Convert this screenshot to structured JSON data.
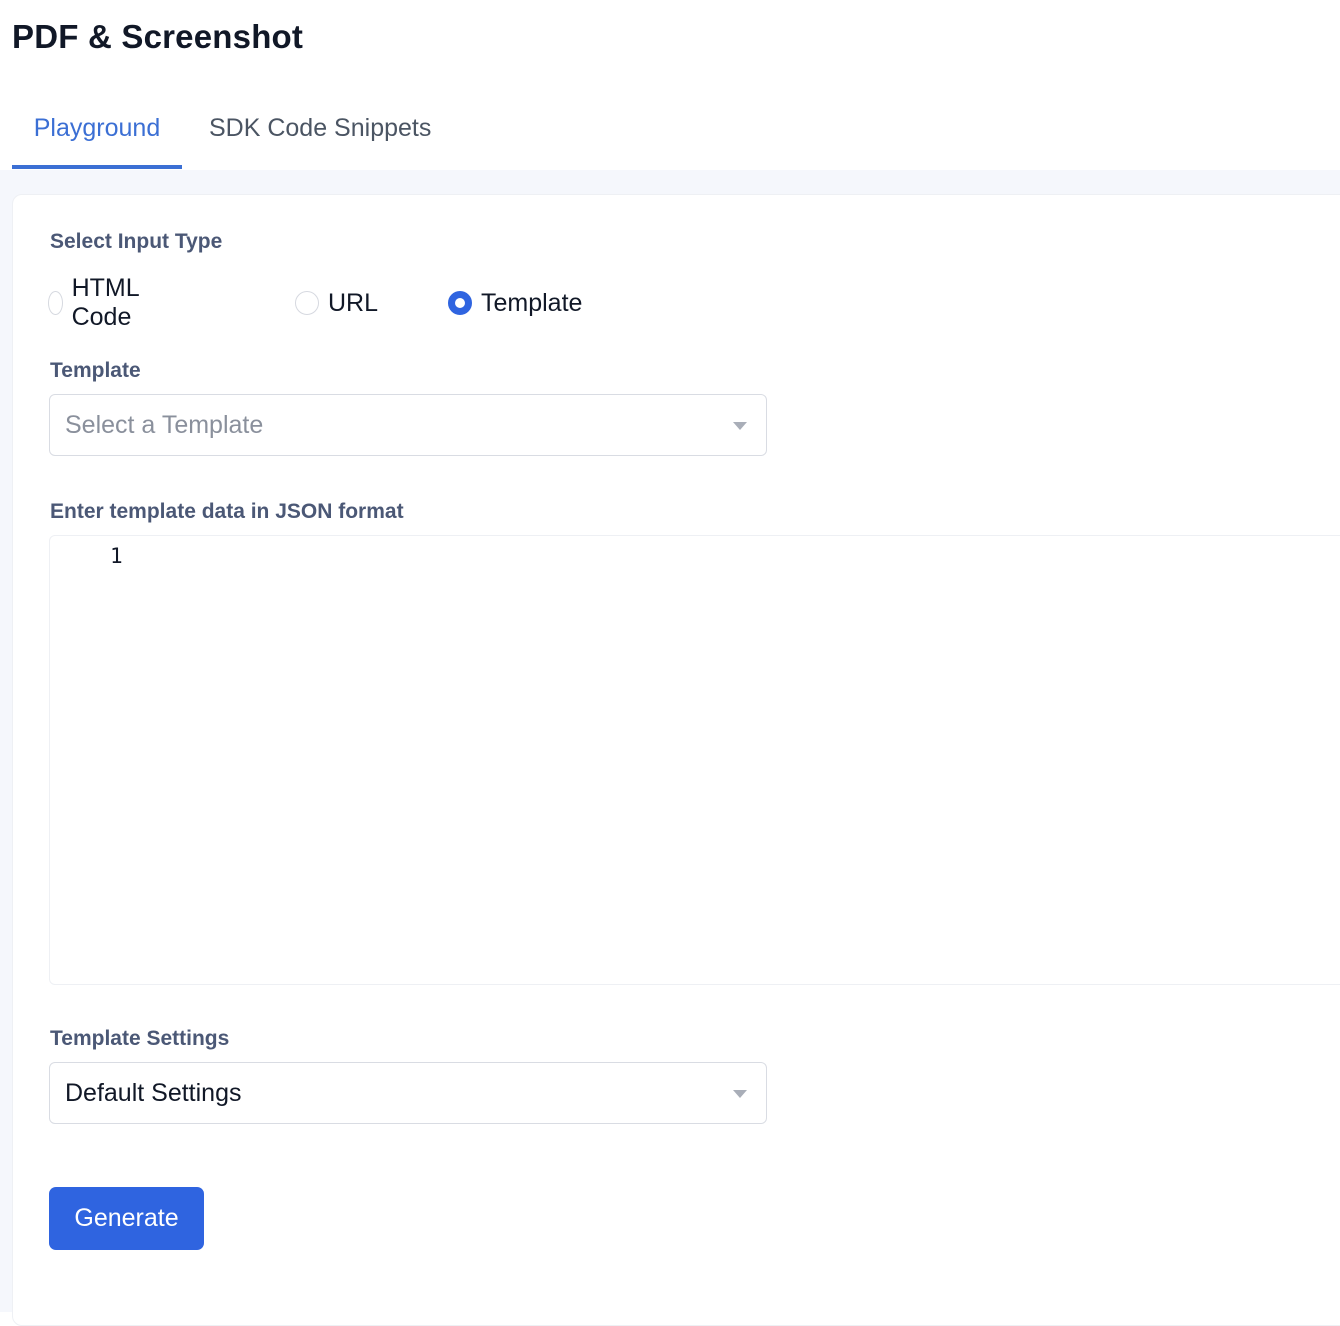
{
  "page": {
    "title": "PDF & Screenshot"
  },
  "tabs": [
    {
      "label": "Playground",
      "active": true
    },
    {
      "label": "SDK Code Snippets",
      "active": false
    }
  ],
  "form": {
    "input_type": {
      "label": "Select Input Type",
      "options": [
        {
          "label": "HTML Code",
          "checked": false
        },
        {
          "label": "URL",
          "checked": false
        },
        {
          "label": "Template",
          "checked": true
        }
      ]
    },
    "template": {
      "label": "Template",
      "placeholder": "Select a Template"
    },
    "template_data": {
      "label": "Enter template data in JSON format",
      "line_number": "1"
    },
    "template_settings": {
      "label": "Template Settings",
      "value": "Default Settings"
    },
    "generate_label": "Generate"
  },
  "colors": {
    "accent": "#2f64e0",
    "tab_active": "#3b6fd4",
    "label": "#4b5876"
  }
}
